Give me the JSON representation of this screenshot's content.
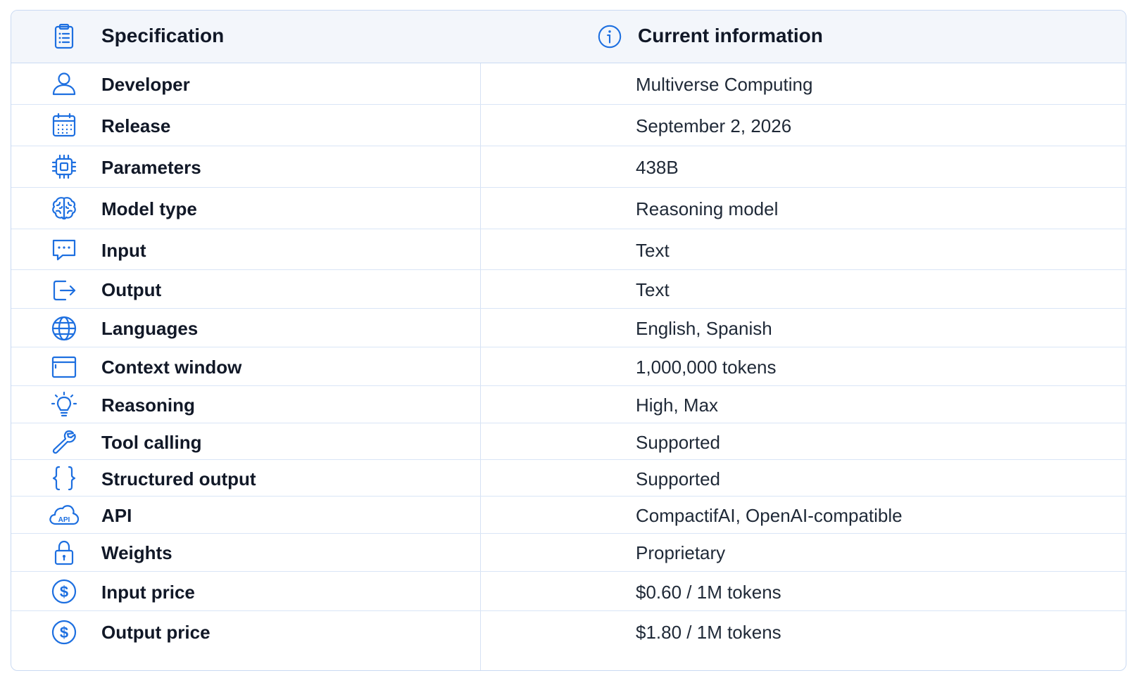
{
  "header": {
    "spec_label": "Specification",
    "info_label": "Current information",
    "spec_icon": "clipboard-list-icon",
    "info_icon": "info-circle-icon"
  },
  "rows": [
    {
      "label": "Developer",
      "value": "Multiverse Computing",
      "icon": "user-icon"
    },
    {
      "label": "Release",
      "value": "September 2, 2026",
      "icon": "calendar-icon"
    },
    {
      "label": "Parameters",
      "value": "438B",
      "icon": "chip-icon"
    },
    {
      "label": "Model type",
      "value": "Reasoning model",
      "icon": "brain-icon"
    },
    {
      "label": "Input",
      "value": "Text",
      "icon": "message-dots-icon"
    },
    {
      "label": "Output",
      "value": "Text",
      "icon": "export-arrow-icon"
    },
    {
      "label": "Languages",
      "value": "English, Spanish",
      "icon": "globe-icon"
    },
    {
      "label": "Context window",
      "value": "1,000,000 tokens",
      "icon": "window-icon"
    },
    {
      "label": "Reasoning",
      "value": "High, Max",
      "icon": "lightbulb-icon"
    },
    {
      "label": "Tool calling",
      "value": "Supported",
      "icon": "wrench-icon"
    },
    {
      "label": "Structured output",
      "value": "Supported",
      "icon": "curly-braces-icon"
    },
    {
      "label": "API",
      "value": "CompactifAI, OpenAI-compatible",
      "icon": "cloud-api-icon",
      "icon_text": "API"
    },
    {
      "label": "Weights",
      "value": "Proprietary",
      "icon": "lock-icon"
    },
    {
      "label": "Input price",
      "value": "$0.60 / 1M tokens",
      "icon": "dollar-circle-icon"
    },
    {
      "label": "Output price",
      "value": "$1.80 / 1M tokens",
      "icon": "dollar-circle-icon"
    }
  ],
  "colors": {
    "accent": "#1d6fe0",
    "header_bg": "#f3f6fb",
    "border": "#c9d9f2"
  }
}
